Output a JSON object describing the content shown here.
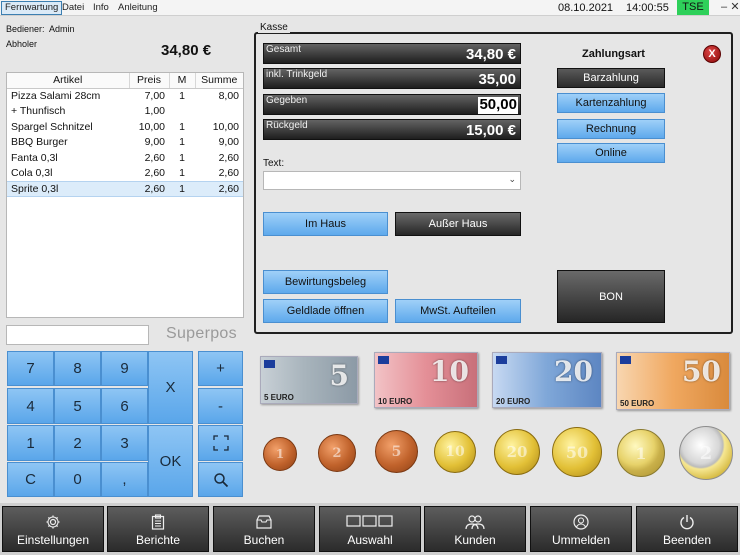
{
  "menu": {
    "items": [
      "Fernwartung",
      "Datei",
      "Info",
      "Anleitung"
    ],
    "date": "08.10.2021",
    "time": "14:00:55",
    "tse": "TSE",
    "window_controls": [
      "minimize-icon",
      "maximize-icon",
      "close-icon"
    ]
  },
  "info": {
    "bediener_label": "Bediener:",
    "bediener_value": "Admin",
    "abholer_label": "Abholer",
    "total": "34,80 €"
  },
  "items_table": {
    "headers": [
      "Artikel",
      "Preis",
      "M",
      "Summe"
    ],
    "rows": [
      [
        "Pizza Salami 28cm",
        "7,00",
        "1",
        "8,00"
      ],
      [
        "+ Thunfisch",
        "1,00",
        "",
        ""
      ],
      [
        "Spargel Schnitzel",
        "10,00",
        "1",
        "10,00"
      ],
      [
        "BBQ Burger",
        "9,00",
        "1",
        "9,00"
      ],
      [
        "Fanta 0,3l",
        "2,60",
        "1",
        "2,60"
      ],
      [
        "Cola 0,3l",
        "2,60",
        "1",
        "2,60"
      ],
      [
        "Sprite 0,3l",
        "2,60",
        "1",
        "2,60"
      ]
    ],
    "selected_row": 6
  },
  "logo": "Superpos",
  "numpad": {
    "keys": [
      "7",
      "8",
      "9",
      "4",
      "5",
      "6",
      "1",
      "2",
      "3",
      "C",
      "0",
      ","
    ],
    "x_label": "X",
    "ok_label": "OK",
    "plus": "+",
    "minus": "-"
  },
  "kasse": {
    "title": "Kasse",
    "gesamt_label": "Gesamt",
    "gesamt_value": "34,80 €",
    "trinkgeld_label": "inkl. Trinkgeld",
    "trinkgeld_value": "35,00",
    "gegeben_label": "Gegeben",
    "gegeben_value": "50,00",
    "rueckgeld_label": "Rückgeld",
    "rueckgeld_value": "15,00 €",
    "text_label": "Text:",
    "text_value": "",
    "im_haus": "Im Haus",
    "ausser_haus": "Außer Haus",
    "bewirtungsbeleg": "Bewirtungsbeleg",
    "geldlade": "Geldlade öffnen",
    "mwst": "MwSt. Aufteilen",
    "bon": "BON",
    "zahlungsart_title": "Zahlungsart",
    "payment_options": [
      "Barzahlung",
      "Kartenzahlung",
      "Rechnung",
      "Online"
    ],
    "payment_selected": "Barzahlung",
    "close": "X"
  },
  "notes": [
    {
      "value": "5",
      "label": "5 EURO",
      "color": "#a8b4bc"
    },
    {
      "value": "10",
      "label": "10 EURO",
      "color": "#e48f97"
    },
    {
      "value": "20",
      "label": "20 EURO",
      "color": "#7fa7d8"
    },
    {
      "value": "50",
      "label": "50 EURO",
      "color": "#f0a860"
    }
  ],
  "coins": [
    {
      "label": "1",
      "type": "cu"
    },
    {
      "label": "2",
      "type": "cu"
    },
    {
      "label": "5",
      "type": "cu"
    },
    {
      "label": "10",
      "type": "au"
    },
    {
      "label": "20",
      "type": "au"
    },
    {
      "label": "50",
      "type": "au"
    },
    {
      "label": "1",
      "type": "bi"
    },
    {
      "label": "2",
      "type": "2e"
    }
  ],
  "bottom": {
    "buttons": [
      {
        "label": "Einstellungen",
        "icon": "gear-icon"
      },
      {
        "label": "Berichte",
        "icon": "clipboard-icon"
      },
      {
        "label": "Buchen",
        "icon": "inbox-icon"
      },
      {
        "label": "Auswahl",
        "icon": "table-select-icon"
      },
      {
        "label": "Kunden",
        "icon": "users-icon"
      },
      {
        "label": "Ummelden",
        "icon": "user-switch-icon"
      },
      {
        "label": "Beenden",
        "icon": "power-icon"
      }
    ]
  }
}
